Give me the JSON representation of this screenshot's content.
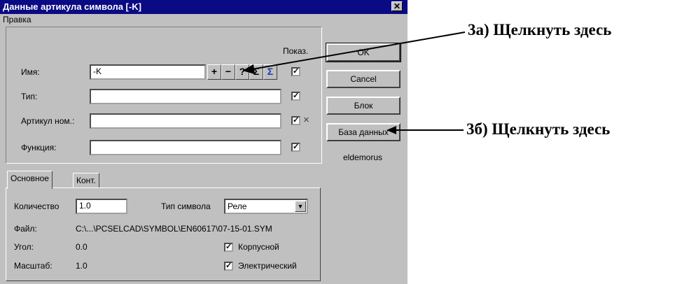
{
  "dialog": {
    "title": "Данные артикула символа [-K]",
    "close": "✕",
    "menu": [
      "Правка"
    ]
  },
  "fields": {
    "show_header": "Показ.",
    "name_label": "Имя:",
    "name_value": "-K",
    "type_label": "Тип:",
    "type_value": "",
    "article_label": "Артикул ном.:",
    "article_value": "",
    "article_clear": "×",
    "function_label": "Функция:",
    "function_value": "",
    "check_mark": "✓"
  },
  "toolbar": {
    "plus": "+",
    "minus": "−",
    "question": "?",
    "sigma": "Σ",
    "sigma_check": "Σ"
  },
  "buttons": {
    "ok": "OK",
    "cancel": "Cancel",
    "block": "Блок",
    "database": "База данных",
    "user_name": "eldemorus"
  },
  "tabs": {
    "main": "Основное",
    "cont": "Конт."
  },
  "panel": {
    "quantity_label": "Количество",
    "quantity_value": "1.0",
    "symbol_type_label": "Тип символа",
    "symbol_type_value": "Реле",
    "file_label": "Файл:",
    "file_value": "C:\\...\\PCSELCAD\\SYMBOL\\EN60617\\07-15-01.SYM",
    "angle_label": "Угол:",
    "angle_value": "0.0",
    "scale_label": "Масштаб:",
    "scale_value": "1.0",
    "body_label": "Корпусной",
    "electrical_label": "Электрический"
  },
  "annotations": {
    "a": "3а) Щелкнуть здесь",
    "b": "3б) Щелкнуть здесь"
  },
  "colors": {
    "titlebar": "#0a0a84",
    "dialog_bg": "#c0c0c0"
  }
}
